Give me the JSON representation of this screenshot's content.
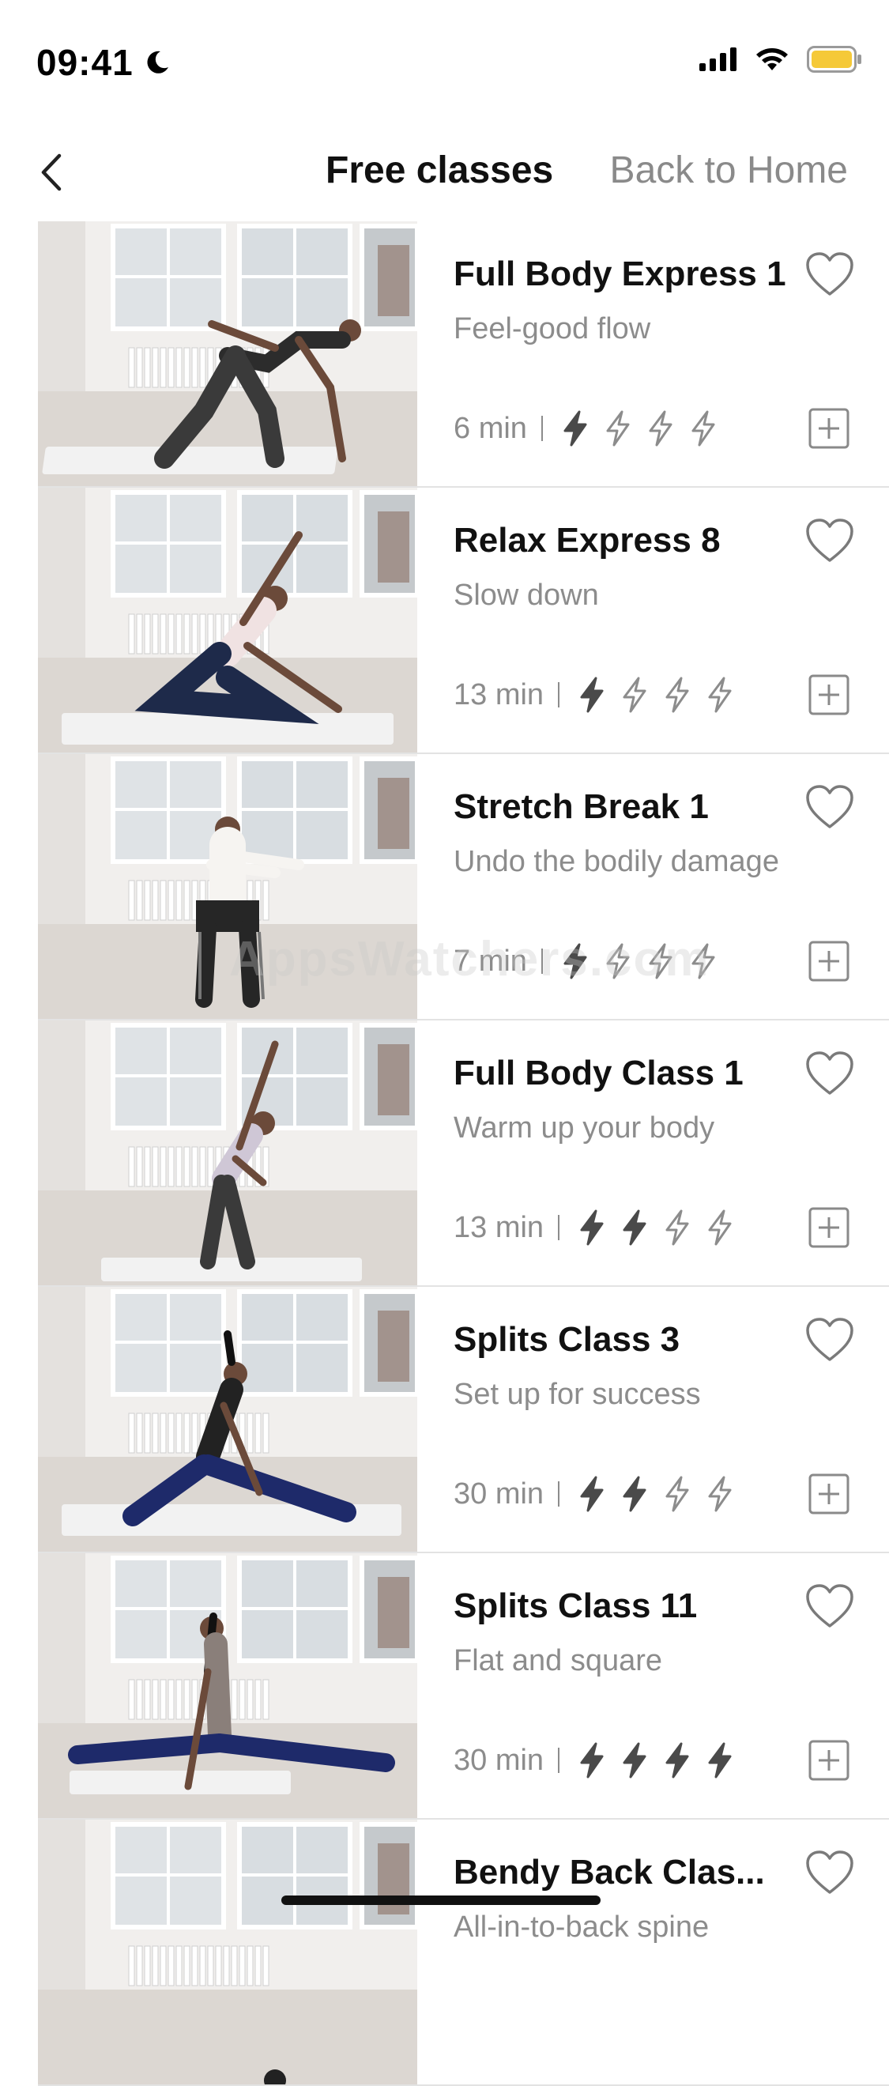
{
  "status_bar": {
    "time": "09:41",
    "icons": [
      "moon-icon",
      "cellular-signal-icon",
      "wifi-icon",
      "battery-icon"
    ],
    "battery_color": "#F5C938"
  },
  "header": {
    "back_icon": "chevron-left-icon",
    "title": "Free classes",
    "home_link": "Back to Home"
  },
  "watermark": "AppsWatchers.com",
  "accent_colors": {
    "bolt_active": "#4a4a4a",
    "bolt_inactive": "#8c8c8c",
    "icon_gray": "#8a8a8a"
  },
  "classes": [
    {
      "title": "Full Body Express 1",
      "subtitle": "Feel-good flow",
      "duration": "6 min",
      "intensity": 1,
      "thumb_desc": "side-plank-stretch"
    },
    {
      "title": "Relax Express 8",
      "subtitle": "Slow down",
      "duration": "13 min",
      "intensity": 1,
      "thumb_desc": "seated-side-bend"
    },
    {
      "title": "Stretch Break 1",
      "subtitle": "Undo the bodily damage",
      "duration": "7 min",
      "intensity": 1,
      "thumb_desc": "chair-twist"
    },
    {
      "title": "Full Body Class 1",
      "subtitle": "Warm up your body",
      "duration": "13 min",
      "intensity": 2,
      "thumb_desc": "standing-side-bend"
    },
    {
      "title": "Splits Class 3",
      "subtitle": "Set up for success",
      "duration": "30 min",
      "intensity": 2,
      "thumb_desc": "seated-straddle"
    },
    {
      "title": "Splits Class 11",
      "subtitle": "Flat and square",
      "duration": "30 min",
      "intensity": 4,
      "thumb_desc": "front-split"
    },
    {
      "title": "Bendy Back Clas...",
      "subtitle": "All-in-to-back spine",
      "duration": "",
      "intensity": 0,
      "thumb_desc": "partial"
    }
  ]
}
